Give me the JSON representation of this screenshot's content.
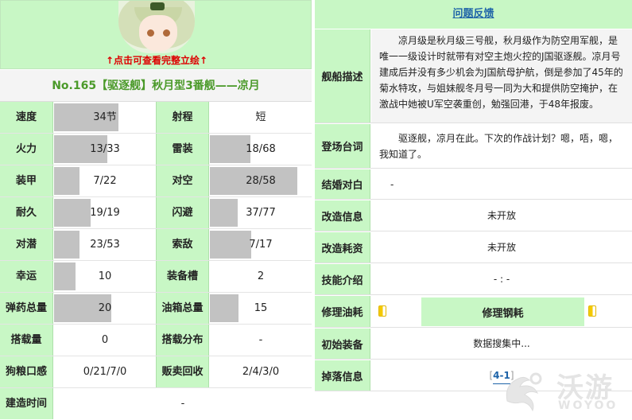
{
  "header": {
    "click_tip": "↑点击可查看完整立绘↑",
    "ship_title": "No.165【驱逐舰】秋月型3番舰——凉月"
  },
  "stats": [
    {
      "l1": "速度",
      "v1": "34节",
      "p1": 0.63,
      "l2": "射程",
      "v2": "短",
      "p2": null
    },
    {
      "l1": "火力",
      "v1": "13/33",
      "p1": 0.52,
      "l2": "雷装",
      "v2": "18/68",
      "p2": 0.4
    },
    {
      "l1": "装甲",
      "v1": "7/22",
      "p1": 0.25,
      "l2": "对空",
      "v2": "28/58",
      "p2": 0.86
    },
    {
      "l1": "耐久",
      "v1": "19/19",
      "p1": 0.36,
      "l2": "闪避",
      "v2": "37/77",
      "p2": 0.27
    },
    {
      "l1": "对潜",
      "v1": "23/53",
      "p1": 0.25,
      "l2": "索敌",
      "v2": "7/17",
      "p2": 0.41
    },
    {
      "l1": "幸运",
      "v1": "10",
      "p1": 0.21,
      "l2": "装备槽",
      "v2": "2",
      "p2": null
    },
    {
      "l1": "弹药总量",
      "v1": "20",
      "p1": 0.56,
      "l2": "油箱总量",
      "v2": "15",
      "p2": 0.28
    },
    {
      "l1": "搭载量",
      "v1": "0",
      "p1": null,
      "l2": "搭载分布",
      "v2": "-",
      "p2": null
    },
    {
      "l1": "狗粮口感",
      "v1": "0/21/7/0",
      "p1": null,
      "l2": "贩卖回收",
      "v2": "2/4/3/0",
      "p2": null
    }
  ],
  "build_time": {
    "label": "建造时间",
    "value": "-"
  },
  "right": {
    "feedback": "问题反馈",
    "desc_label": "舰船描述",
    "desc_text": "凉月级是秋月级三号舰，秋月级作为防空用军舰，是唯一一级设计时就带有对空主炮火控的J国驱逐舰。凉月号建成后并没有多少机会为J国航母护航，倒是参加了45年的菊水特攻，与姐妹舰冬月号一同为大和提供防空掩护，在激战中她被U军空袭重创，勉强回港，于48年报废。",
    "lines_label": "登场台词",
    "lines_text": "驱逐舰，凉月在此。下次的作战计划？嗯，唔，嗯，我知道了。",
    "marriage_label": "结婚对白",
    "marriage_text": "-",
    "remodel_label": "改造信息",
    "remodel_text": "未开放",
    "remodel_cost_label": "改造耗资",
    "remodel_cost_text": "未开放",
    "skill_label": "技能介绍",
    "skill_text": "- : -",
    "repair_oil_label": "修理油耗",
    "repair_steel_label": "修理钢耗",
    "init_equip_label": "初始装备",
    "init_equip_text": "数据搜集中...",
    "drop_label": "掉落信息",
    "drop_text": "4-1"
  },
  "watermark": {
    "cn": "沃游",
    "en": "WOYOO"
  }
}
